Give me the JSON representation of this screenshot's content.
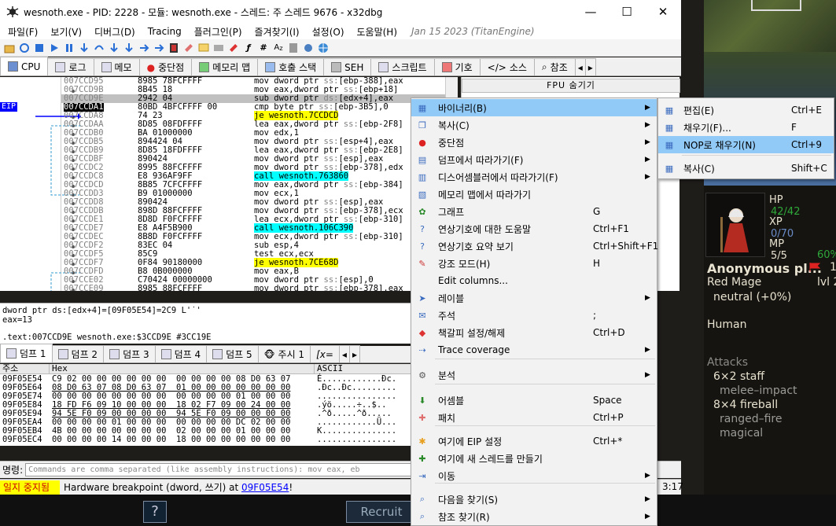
{
  "window": {
    "title": "wesnoth.exe - PID: 2228 - 모듈: wesnoth.exe - 스레드: 주 스레드 9676 - x32dbg",
    "minimize": "—",
    "maximize": "☐",
    "close": "✕"
  },
  "menubar": {
    "items": [
      "파일(F)",
      "보기(V)",
      "디버그(D)",
      "Tracing",
      "플러그인(P)",
      "즐겨찾기(I)",
      "설정(O)",
      "도움말(H)"
    ],
    "build": "Jan 15 2023 (TitanEngine)"
  },
  "tabs": [
    "CPU",
    "로그",
    "메모",
    "중단점",
    "메모리 맵",
    "호출 스택",
    "SEH",
    "스크립트",
    "기호",
    "소스",
    "참조"
  ],
  "eip_label": "EIP",
  "disasm": {
    "rows": [
      {
        "addr": "007CCD95",
        "bytes": "8985 78FCFFFF",
        "inst": "mov dword ptr ss:[ebp-388],eax"
      },
      {
        "addr": "007CCD9B",
        "bytes": "8B45 18",
        "inst": "mov eax,dword ptr ss:[ebp+18]"
      },
      {
        "addr": "007CCD9E",
        "bytes": "2942 04",
        "inst": "sub dword ptr ds:[edx+4],eax"
      },
      {
        "addr": "007CCDA1",
        "bytes": "80BD 4BFCFFFF 00",
        "inst": "cmp byte ptr ss:[ebp-3B5],0"
      },
      {
        "addr": "007CCDA8",
        "bytes": "74 23",
        "inst": "je wesnoth.7CCDCD"
      },
      {
        "addr": "007CCDAA",
        "bytes": "8D85 08FDFFFF",
        "inst": "lea eax,dword ptr ss:[ebp-2F8]"
      },
      {
        "addr": "007CCDB0",
        "bytes": "BA 01000000",
        "inst": "mov edx,1"
      },
      {
        "addr": "007CCDB5",
        "bytes": "894424 04",
        "inst": "mov dword ptr ss:[esp+4],eax"
      },
      {
        "addr": "007CCDB9",
        "bytes": "8D85 18FDFFFF",
        "inst": "lea eax,dword ptr ss:[ebp-2E8]"
      },
      {
        "addr": "007CCDBF",
        "bytes": "890424",
        "inst": "mov dword ptr ss:[esp],eax"
      },
      {
        "addr": "007CCDC2",
        "bytes": "8995 88FCFFFF",
        "inst": "mov dword ptr ss:[ebp-378],edx"
      },
      {
        "addr": "007CCDC8",
        "bytes": "E8 936AF9FF",
        "inst": "call wesnoth.763860"
      },
      {
        "addr": "007CCDCD",
        "bytes": "8B85 7CFCFFFF",
        "inst": "mov eax,dword ptr ss:[ebp-384]"
      },
      {
        "addr": "007CCDD3",
        "bytes": "B9 01000000",
        "inst": "mov ecx,1"
      },
      {
        "addr": "007CCDD8",
        "bytes": "890424",
        "inst": "mov dword ptr ss:[esp],eax"
      },
      {
        "addr": "007CCDDB",
        "bytes": "898D 88FCFFFF",
        "inst": "mov dword ptr ss:[ebp-378],ecx"
      },
      {
        "addr": "007CCDE1",
        "bytes": "8D8D F0FCFFFF",
        "inst": "lea ecx,dword ptr ss:[ebp-310]"
      },
      {
        "addr": "007CCDE7",
        "bytes": "E8 A4F5B900",
        "inst": "call wesnoth.106C390"
      },
      {
        "addr": "007CCDEC",
        "bytes": "8B8D F0FCFFFF",
        "inst": "mov ecx,dword ptr ss:[ebp-310]"
      },
      {
        "addr": "007CCDF2",
        "bytes": "83EC 04",
        "inst": "sub esp,4"
      },
      {
        "addr": "007CCDF5",
        "bytes": "85C9",
        "inst": "test ecx,ecx"
      },
      {
        "addr": "007CCDF7",
        "bytes": "0F84 90180000",
        "inst": "je wesnoth.7CE68D"
      },
      {
        "addr": "007CCDFD",
        "bytes": "B8 0B000000",
        "inst": "mov eax,B"
      },
      {
        "addr": "007CCE02",
        "bytes": "C70424 00000000",
        "inst": "mov dword ptr ss:[esp],0"
      },
      {
        "addr": "007CCE09",
        "bytes": "8985 88FCFFFF",
        "inst": "mov dword ptr ss:[ebp-378],eax"
      }
    ]
  },
  "fpu_header": "FPU 숨기기",
  "info": {
    "line1": "dword ptr ds:[edx+4]=[09F05E54]=2C9 L'˙'",
    "line2": "eax=13",
    "line3": ".text:007CCD9E wesnoth.exe:$3CCD9E #3CC19E"
  },
  "dump_tabs": [
    "덤프 1",
    "덤프 2",
    "덤프 3",
    "덤프 4",
    "덤프 5",
    "주시 1",
    "[x="
  ],
  "dump": {
    "headers": {
      "addr": "주소",
      "hex": "Hex",
      "ascii": "ASCII"
    },
    "rows": [
      {
        "addr": "09F05E54",
        "hex": "C9 02 00 00 00 00 00 00  00 00 00 00 08 D0 63 07",
        "ascii": "É............Ðc."
      },
      {
        "addr": "09F05E64",
        "hex": "08 D0 63 07 08 D0 63 07  01 00 00 00 00 00 00 00",
        "ascii": ".Ðc..Ðc........."
      },
      {
        "addr": "09F05E74",
        "hex": "00 00 00 00 00 00 00 00  00 00 00 00 01 00 00 00",
        "ascii": "................"
      },
      {
        "addr": "09F05E84",
        "hex": "18 FD F6 09 10 00 00 00  18 02 F7 09 00 24 00 00",
        "ascii": ".ýö.....÷..$.."
      },
      {
        "addr": "09F05E94",
        "hex": "94 5E F0 09 00 00 00 00  94 5E F0 09 00 00 00 00",
        "ascii": ".^ð.....^ð....."
      },
      {
        "addr": "09F05EA4",
        "hex": "00 00 00 00 01 00 00 00  00 00 00 00 DC 02 00 00",
        "ascii": "............Ü..."
      },
      {
        "addr": "09F05EB4",
        "hex": "4B 00 00 00 00 00 00 00  02 00 00 00 01 00 00 00",
        "ascii": "K..............."
      },
      {
        "addr": "09F05EC4",
        "hex": "00 00 00 00 14 00 00 00  18 00 00 00 00 00 00 00",
        "ascii": "................"
      }
    ]
  },
  "cmdline": {
    "label": "명령:",
    "placeholder": "Commands are comma separated (like assembly instructions): mov eax, eb"
  },
  "status": {
    "state": "일지 중지됨",
    "message_prefix": "Hardware breakpoint (dword, 쓰기) at ",
    "message_link": "09F05E54",
    "message_suffix": "!",
    "clock": "3:17"
  },
  "context_menu": {
    "items": [
      {
        "label": "바이너리(B)",
        "shortcut": "",
        "submenu": true,
        "icon": "binary-icon"
      },
      {
        "label": "복사(C)",
        "shortcut": "",
        "submenu": true,
        "icon": "copy-icon"
      },
      {
        "label": "중단점",
        "shortcut": "",
        "submenu": true,
        "icon": "breakpoint-icon"
      },
      {
        "label": "덤프에서 따라가기(F)",
        "shortcut": "",
        "submenu": true,
        "icon": "dump-follow-icon"
      },
      {
        "label": "디스어셈블러에서 따라가기(F)",
        "shortcut": "",
        "submenu": true,
        "icon": "disasm-follow-icon"
      },
      {
        "label": "메모리 맵에서 따라가기",
        "shortcut": "",
        "submenu": false,
        "icon": "memmap-icon"
      },
      {
        "label": "그래프",
        "shortcut": "G",
        "submenu": false,
        "icon": "graph-icon"
      },
      {
        "label": "연상기호에 대한 도움말",
        "shortcut": "Ctrl+F1",
        "submenu": false,
        "icon": "help-icon"
      },
      {
        "label": "연상기호 요약 보기",
        "shortcut": "Ctrl+Shift+F1",
        "submenu": false,
        "icon": "summary-icon"
      },
      {
        "label": "강조 모드(H)",
        "shortcut": "H",
        "submenu": false,
        "icon": "highlight-icon"
      },
      {
        "label": "Edit columns...",
        "shortcut": "",
        "submenu": false,
        "icon": ""
      },
      {
        "label": "레이블",
        "shortcut": "",
        "submenu": true,
        "icon": "label-icon"
      },
      {
        "label": "주석",
        "shortcut": ";",
        "submenu": false,
        "icon": "comment-icon"
      },
      {
        "label": "책갈피 설정/해제",
        "shortcut": "Ctrl+D",
        "submenu": false,
        "icon": "bookmark-icon"
      },
      {
        "label": "Trace coverage",
        "shortcut": "",
        "submenu": true,
        "icon": "trace-icon"
      },
      {
        "label": "분석",
        "shortcut": "",
        "submenu": true,
        "icon": "analysis-icon"
      },
      {
        "label": "어셈블",
        "shortcut": "Space",
        "submenu": false,
        "icon": "assemble-icon"
      },
      {
        "label": "패치",
        "shortcut": "Ctrl+P",
        "submenu": false,
        "icon": "patch-icon"
      },
      {
        "label": "여기에 EIP 설정",
        "shortcut": "Ctrl+*",
        "submenu": false,
        "icon": "set-eip-icon"
      },
      {
        "label": "여기에 새 스레드를 만들기",
        "shortcut": "",
        "submenu": false,
        "icon": "new-thread-icon"
      },
      {
        "label": "이동",
        "shortcut": "",
        "submenu": true,
        "icon": "goto-icon"
      },
      {
        "label": "다음을 찾기(S)",
        "shortcut": "",
        "submenu": true,
        "icon": "search-icon"
      },
      {
        "label": "참조 찾기(R)",
        "shortcut": "",
        "submenu": true,
        "icon": "find-refs-icon"
      }
    ]
  },
  "submenu": {
    "items": [
      {
        "label": "편집(E)",
        "shortcut": "Ctrl+E"
      },
      {
        "label": "채우기(F)...",
        "shortcut": "F"
      },
      {
        "label": "NOP로 채우기(N)",
        "shortcut": "Ctrl+9"
      },
      {
        "label": "복사(C)",
        "shortcut": "Shift+C"
      }
    ]
  },
  "game": {
    "hp_label": "HP",
    "hp": "42/42",
    "xp_label": "XP",
    "xp": "0/70",
    "mp_label": "MP",
    "mp": "5/5",
    "percent": "60%",
    "name": "Anonymous pl...",
    "side": "1",
    "unit_type": "Red Mage",
    "level": "lvl 2",
    "alignment": "neutral (+0%)",
    "race": "Human",
    "attacks_label": "Attacks",
    "attack1": "6×2 staff",
    "attack1_type": "melee–impact",
    "attack2": "8×4 fireball",
    "attack2_type": "ranged–fire",
    "attack2_special": "magical",
    "recruit": "Recruit",
    "help_button": "?"
  },
  "colors": {
    "menu_hover": "#91c9f7",
    "status_bg": "#ffff00",
    "eip_blue": "#0000ff",
    "game_green": "#2ea83a"
  }
}
